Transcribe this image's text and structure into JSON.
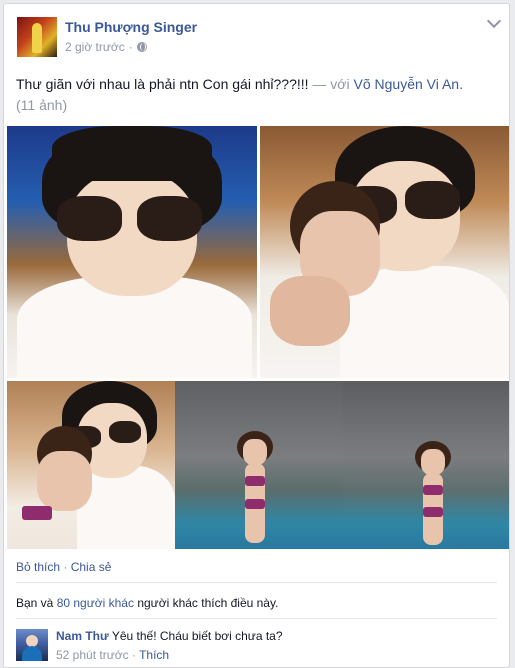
{
  "post": {
    "author": "Thu Phượng Singer",
    "timestamp": "2 giờ trước",
    "privacy_icon": "globe-icon",
    "text": "Thư giãn với nhau là phải ntn Con gái nhỉ???!!!",
    "with_prefix": "— với",
    "tagged_name": "Võ Nguyễn Vi An.",
    "photo_count": "(11 ảnh)"
  },
  "actions": {
    "unlike": "Bỏ thích",
    "separator": "·",
    "share": "Chia sẻ"
  },
  "likes": {
    "prefix": "Bạn và",
    "others_link": "80 người khác",
    "suffix": "người khác thích điều này."
  },
  "comment": {
    "author": "Nam Thư",
    "text": "Yêu thế! Cháu biết bơi chưa ta?",
    "time": "52 phút trước",
    "separator": "·",
    "like": "Thích"
  },
  "colors": {
    "link": "#3b5998",
    "muted": "#9197a3",
    "text": "#141823"
  }
}
